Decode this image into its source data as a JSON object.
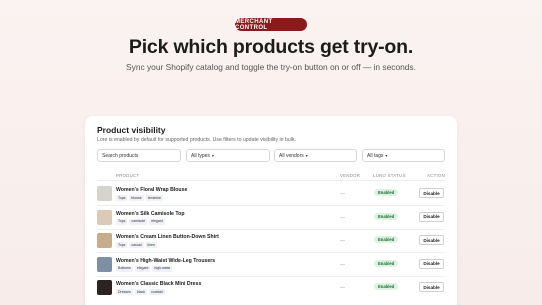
{
  "hero": {
    "badge": "MERCHANT CONTROL",
    "title": "Pick which products get try-on.",
    "subtitle": "Sync your Shopify catalog and toggle the try-on button on or off — in seconds."
  },
  "card": {
    "title": "Product visibility",
    "description": "Lore is enabled by default for supported products. Use filters to update visibility in bulk.",
    "search_placeholder": "Search products",
    "filters": [
      {
        "label": "All types"
      },
      {
        "label": "All vendors"
      },
      {
        "label": "All tags"
      }
    ],
    "columns": {
      "product": "PRODUCT",
      "vendor": "VENDOR",
      "status": "LURO STATUS",
      "action": "ACTION"
    }
  },
  "products": [
    {
      "name": "Women's Floral Wrap Blouse",
      "tags": [
        "Tops",
        "blouse",
        "feminine"
      ],
      "vendor": "—",
      "status": "Enabled",
      "action": "Disable",
      "thumb_color": "#d7d4ce"
    },
    {
      "name": "Women's Silk Camisole Top",
      "tags": [
        "Tops",
        "camisole",
        "elegant"
      ],
      "vendor": "—",
      "status": "Enabled",
      "action": "Disable",
      "thumb_color": "#d9cbb5"
    },
    {
      "name": "Women's Cream Linen Button-Down Shirt",
      "tags": [
        "Tops",
        "casual",
        "linen"
      ],
      "vendor": "—",
      "status": "Enabled",
      "action": "Disable",
      "thumb_color": "#c8ad8a"
    },
    {
      "name": "Women's High-Waist Wide-Leg Trousers",
      "tags": [
        "Bottoms",
        "elegant",
        "high-waist"
      ],
      "vendor": "—",
      "status": "Enabled",
      "action": "Disable",
      "thumb_color": "#7e8ea3"
    },
    {
      "name": "Women's Classic Black Mini Dress",
      "tags": [
        "Dresses",
        "black",
        "cocktail"
      ],
      "vendor": "—",
      "status": "Enabled",
      "action": "Disable",
      "thumb_color": "#2b2422"
    }
  ]
}
